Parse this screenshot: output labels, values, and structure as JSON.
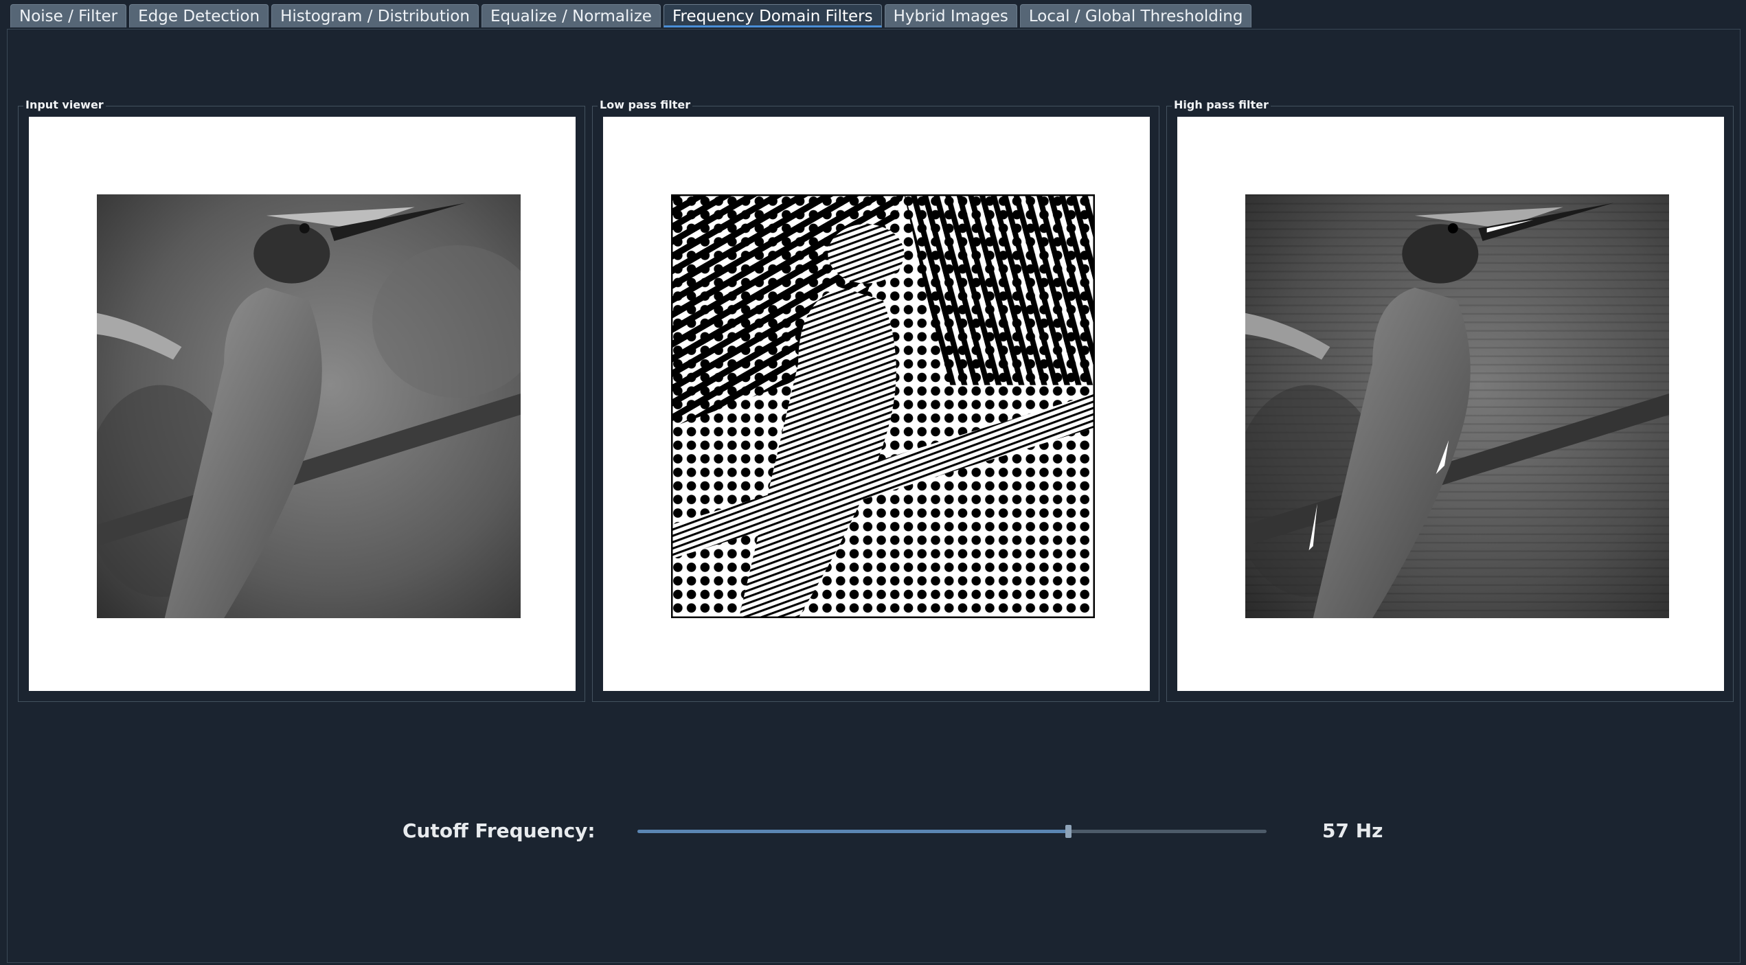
{
  "tabs": [
    {
      "label": "Noise / Filter",
      "active": false
    },
    {
      "label": "Edge Detection",
      "active": false
    },
    {
      "label": "Histogram / Distribution",
      "active": false
    },
    {
      "label": "Equalize / Normalize",
      "active": false
    },
    {
      "label": "Frequency Domain Filters",
      "active": true
    },
    {
      "label": "Hybrid Images",
      "active": false
    },
    {
      "label": "Local / Global Thresholding",
      "active": false
    }
  ],
  "panels": {
    "input": {
      "title": "Input viewer"
    },
    "low_pass": {
      "title": "Low pass filter"
    },
    "high_pass": {
      "title": "High pass filter"
    }
  },
  "cutoff": {
    "label": "Cutoff Frequency:",
    "value_text": "57 Hz",
    "fraction": 0.685
  },
  "colors": {
    "background": "#1b2430",
    "accent": "#4a8fd8",
    "slider_fill": "#5b86b3"
  }
}
